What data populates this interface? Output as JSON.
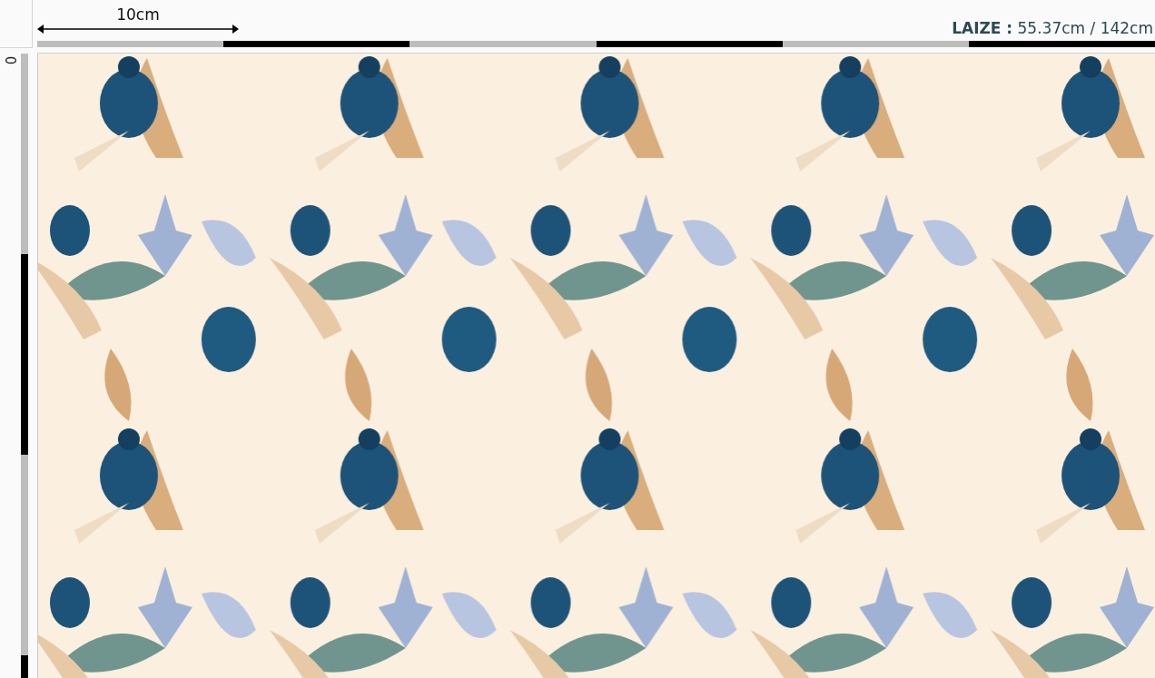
{
  "ruler_top": {
    "scale_label": "10cm",
    "width_label": "**LAIZE :** 55.37cm / 142cm"
  },
  "ruler_left": {
    "origin_label": "0"
  }
}
